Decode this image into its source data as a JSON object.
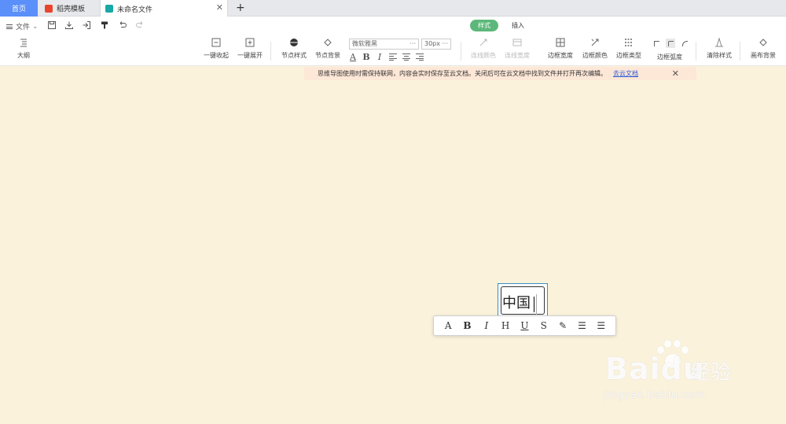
{
  "tabs": {
    "home": "首页",
    "template": "稻壳模板",
    "file": "未命名文件",
    "close": "✕",
    "add": "+"
  },
  "toolbar": {
    "file_menu": "文件",
    "mode_style": "样式",
    "mode_insert": "插入",
    "outline": "大纲",
    "collapse_all": "一键收起",
    "expand_all": "一键展开",
    "node_style": "节点样式",
    "node_bg": "节点背景",
    "font_name": "微软雅黑",
    "font_size": "30px",
    "more": "···",
    "line_color": "连线颜色",
    "line_width": "连线宽度",
    "border_width": "边框宽度",
    "border_color": "边框颜色",
    "border_type": "边框类型",
    "border_radius": "边框弧度",
    "clear_style": "清除样式",
    "canvas_bg": "画布背景"
  },
  "notice": {
    "text": "思维导图使用时需保持联网，内容会实时保存至云文档。关闭后可在云文档中找到文件并打开再次编辑。",
    "link": "去云文档",
    "close": "✕"
  },
  "node": {
    "text": "中国"
  },
  "float_toolbar": {
    "font": "A",
    "bold": "B",
    "italic": "I",
    "heading": "H",
    "underline": "U",
    "strike": "S",
    "magic": "✎",
    "ul": "☰",
    "ol": "☰"
  },
  "watermark": {
    "brand": "Baidu",
    "cn": "经验",
    "url": "jingyan.baidu.com"
  },
  "colors": {
    "canvas": "#fbf2dc",
    "accent": "#5cb87a",
    "home_tab": "#5b8ff9",
    "notice": "#fde7d7"
  }
}
